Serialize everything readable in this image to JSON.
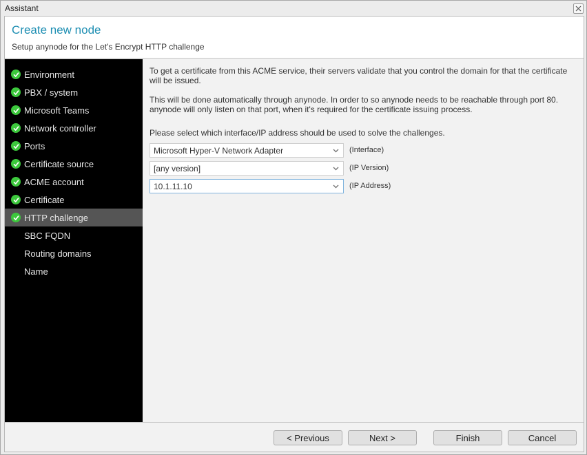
{
  "window": {
    "title": "Assistant",
    "close_icon": "close-icon"
  },
  "header": {
    "title": "Create new node",
    "subtitle": "Setup anynode for the Let's Encrypt HTTP challenge"
  },
  "sidebar": {
    "items": [
      {
        "label": "Environment",
        "completed": true,
        "active": false
      },
      {
        "label": "PBX / system",
        "completed": true,
        "active": false
      },
      {
        "label": "Microsoft Teams",
        "completed": true,
        "active": false
      },
      {
        "label": "Network controller",
        "completed": true,
        "active": false
      },
      {
        "label": "Ports",
        "completed": true,
        "active": false
      },
      {
        "label": "Certificate source",
        "completed": true,
        "active": false
      },
      {
        "label": "ACME account",
        "completed": true,
        "active": false
      },
      {
        "label": "Certificate",
        "completed": true,
        "active": false
      },
      {
        "label": "HTTP challenge",
        "completed": true,
        "active": true
      },
      {
        "label": "SBC FQDN",
        "completed": false,
        "active": false
      },
      {
        "label": "Routing domains",
        "completed": false,
        "active": false
      },
      {
        "label": "Name",
        "completed": false,
        "active": false
      }
    ]
  },
  "main": {
    "paragraph1": "To get a certificate from this ACME service, their servers validate that you control the domain for that the certificate will be issued.",
    "paragraph2_line1": "This will be done automatically through anynode. In order to so anynode needs to be reachable through port 80.",
    "paragraph2_line2": "anynode will only listen on that port, when it's required for the certificate issuing process.",
    "paragraph3": "Please select which interface/IP address should be used to solve the challenges.",
    "fields": [
      {
        "value": "Microsoft Hyper-V Network Adapter",
        "label": "(Interface)"
      },
      {
        "value": "[any version]",
        "label": "(IP Version)"
      },
      {
        "value": "10.1.11.10",
        "label": "(IP Address)"
      }
    ]
  },
  "footer": {
    "previous": "< Previous",
    "next": "Next >",
    "finish": "Finish",
    "cancel": "Cancel"
  },
  "colors": {
    "accent": "#1f8fb3",
    "check_green": "#3cc83c",
    "sidebar_bg": "#000000",
    "sidebar_active": "#555555"
  }
}
